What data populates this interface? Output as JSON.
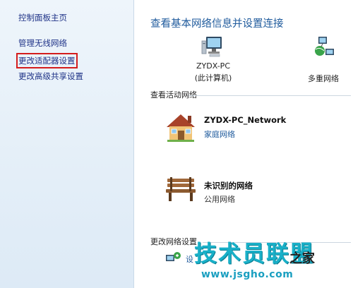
{
  "sidebar": {
    "items": [
      {
        "label": "控制面板主页"
      },
      {
        "label": "管理无线网络"
      },
      {
        "label": "更改适配器设置"
      },
      {
        "label": "更改高级共享设置"
      }
    ]
  },
  "main": {
    "heading": "查看基本网络信息并设置连接",
    "computer": {
      "name": "ZYDX-PC",
      "sub": "(此计算机)"
    },
    "multi_network": "多重网络",
    "active_section": "查看活动网络",
    "networks": [
      {
        "name": "ZYDX-PC_Network",
        "type": "家庭网络"
      },
      {
        "name": "未识别的网络",
        "type": "公用网络"
      }
    ],
    "change_section": "更改网络设置",
    "settings_partial": "设"
  },
  "watermark": {
    "main": "技术员联盟",
    "secondary": "之家",
    "url": "www.jsgho.com"
  }
}
